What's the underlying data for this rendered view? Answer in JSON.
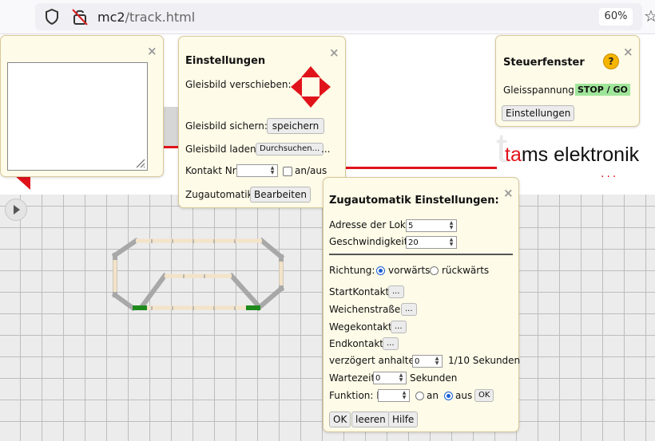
{
  "browser": {
    "url_host": "mc2",
    "url_path": "/track.html",
    "zoom": "60%"
  },
  "logo": {
    "t": "ta",
    "rest": "ms elektronik",
    "dots": "..."
  },
  "einstellungen": {
    "title": "Einstellungen",
    "verschieben_label": "Gleisbild verschieben:",
    "sichern_label": "Gleisbild sichern:",
    "sichern_button": "speichern",
    "laden_label": "Gleisbild laden:",
    "laden_button": "Durchsuchen...",
    "laden_ellipsis": "...",
    "kontakt_label": "Kontakt Nr:",
    "anaus_label": "an/aus",
    "zugautomatik_label": "Zugautomatik:",
    "zugautomatik_button": "Bearbeiten"
  },
  "steuerfenster": {
    "title": "Steuerfenster",
    "help": "?",
    "gleisspannung_label": "Gleisspannung:",
    "stopgo": "STOP / GO",
    "einstellungen_button": "Einstellungen"
  },
  "zug": {
    "title": "Zugautomatik Einstellungen:",
    "adresse_label": "Adresse der Lok:",
    "adresse_value": "5",
    "geschw_label": "Geschwindigkeit:",
    "geschw_value": "20",
    "richtung_label": "Richtung:",
    "vorwaerts": "vorwärts",
    "rueckwaerts": "rückwärts",
    "startkontakt": "StartKontakt:",
    "weichenstrasse": "Weichenstraße:",
    "wegekontakt": "Wegekontakt:",
    "endkontakt": "Endkontakt:",
    "dots_button": "...",
    "verzoegert_label": "verzögert anhalten",
    "verzoegert_value": "0",
    "verzoegert_unit": "1/10 Sekunden",
    "wartezeit_label": "Wartezeit:",
    "wartezeit_value": "0",
    "wartezeit_unit": "Sekunden",
    "funktion_label": "Funktion: F",
    "an": "an",
    "aus": "aus",
    "ok_small": "OK",
    "ok": "OK",
    "leeren": "leeren",
    "hilfe": "Hilfe"
  },
  "icons": {
    "close": "×",
    "star": "☆"
  }
}
